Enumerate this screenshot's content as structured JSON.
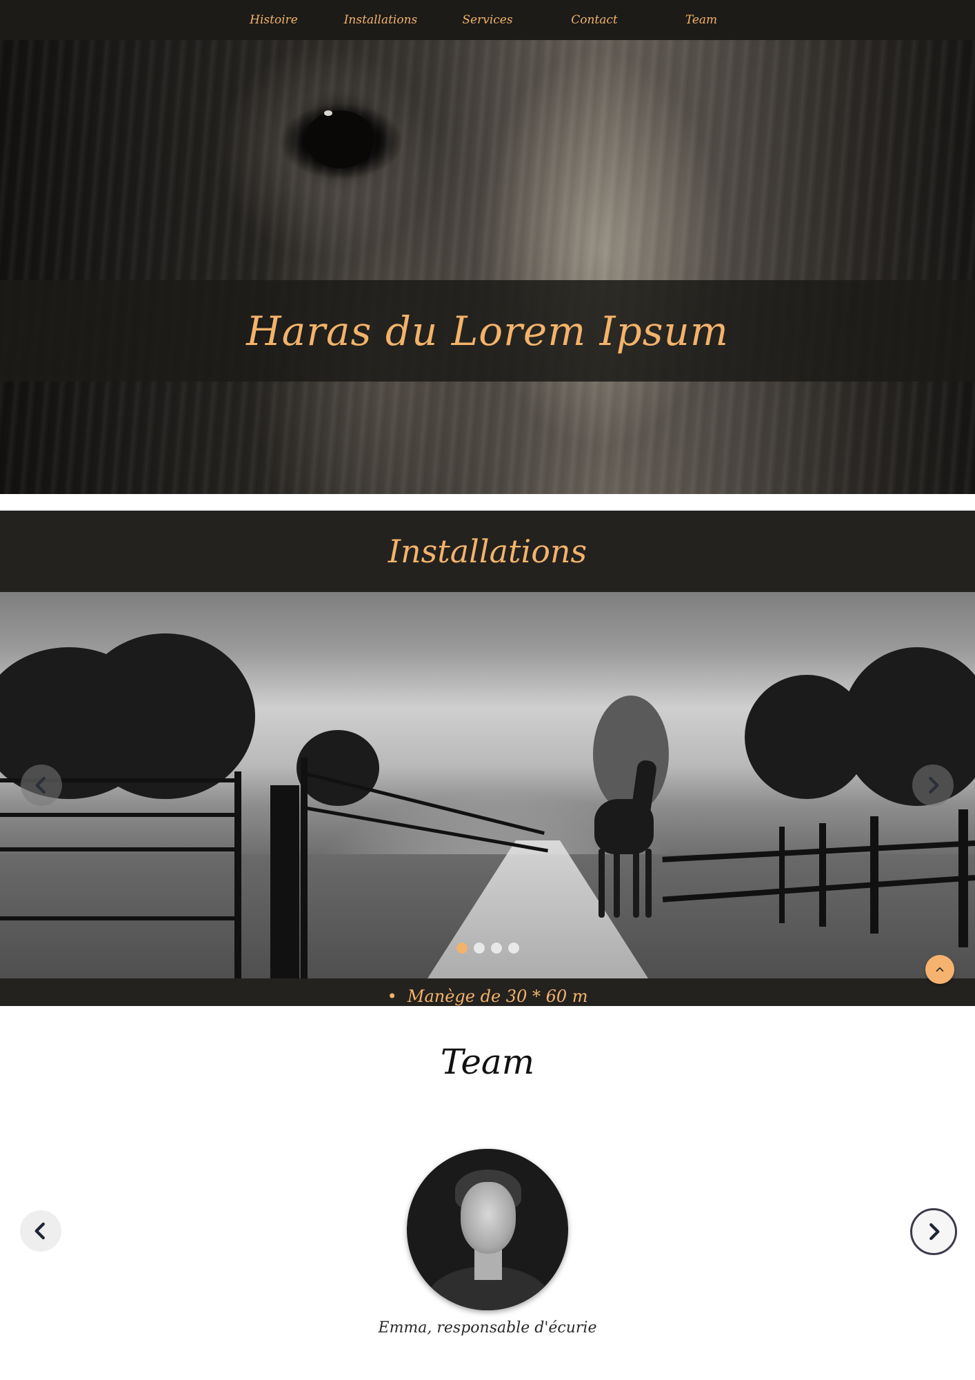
{
  "nav": {
    "items": [
      "Histoire",
      "Installations",
      "Services",
      "Contact",
      "Team"
    ]
  },
  "hero": {
    "title": "Haras du Lorem Ipsum"
  },
  "installations": {
    "title": "Installations",
    "carousel": {
      "slides": 4,
      "active_slide": 1
    },
    "list_first_item": "Manège de 30 * 60 m"
  },
  "team": {
    "title": "Team",
    "member": {
      "caption": "Emma, responsable d'écurie"
    }
  },
  "colors": {
    "accent": "#f3b36b",
    "dark": "#24221f"
  }
}
